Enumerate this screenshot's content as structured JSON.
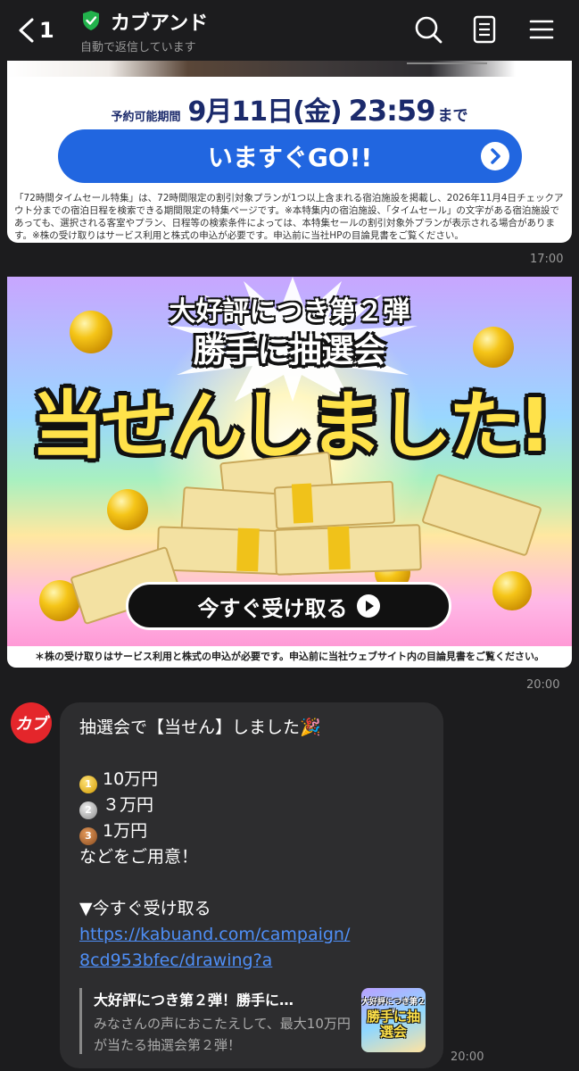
{
  "header": {
    "back_count": "1",
    "title": "カブアンド",
    "subtitle": "自動で返信しています"
  },
  "card1": {
    "period_label": "予約可能期間",
    "period_date": "9月11日(金)",
    "period_time": "23:59",
    "period_suffix": "まで",
    "go_button": "いますぐGO!!",
    "fine_print": "「72時間タイムセール特集」は、72時間限定の割引対象プランが1つ以上含まれる宿泊施設を掲載し、2026年11月4日チェックアウト分までの宿泊日程を検索できる期間限定の特集ページです。※本特集内の宿泊施設、「タイムセール」の文字がある宿泊施設であっても、選択される客室やプラン、日程等の検索条件によっては、本特集セールの割引対象外プランが表示される場合があります。※株の受け取りはサービス利用と株式の申込が必要です。申込前に当社HPの目論見書をご覧ください。",
    "time": "17:00"
  },
  "banner": {
    "sub_head_1": "大好評につき第２弾",
    "sub_head_2": "勝手に抽選会",
    "big_head": "当せんしました!",
    "button": "今すぐ受け取る",
    "note": "＊株の受け取りはサービス利用と株式の申込が必要です。申込前に当社ウェブサイト内の目論見書をご覧ください。",
    "time": "20:00"
  },
  "message": {
    "avatar_text": "カブ",
    "line1": "抽選会で【当せん】しました🎉",
    "prize1": "10万円",
    "prize2": "３万円",
    "prize3": "1万円",
    "medal1": "1",
    "medal2": "2",
    "medal3": "3",
    "line5": "などをご用意！",
    "line6": "▼今すぐ受け取る",
    "link_line1": "https://kabuand.com/campaign/",
    "link_line2": "8cd953bfec/drawing?a",
    "preview_title": "大好評につき第２弾！勝手に…",
    "preview_desc": "みなさんの声におこたえして、最大10万円が当たる抽選会第２弾！",
    "thumb_line1": "大好評につき第２弾",
    "thumb_line2": "勝手に抽選会",
    "time": "20:00"
  },
  "colors": {
    "accent_blue": "#2166e0",
    "link": "#4f8ff7",
    "brand_red": "#e4262b",
    "badge_green": "#22b24c"
  }
}
